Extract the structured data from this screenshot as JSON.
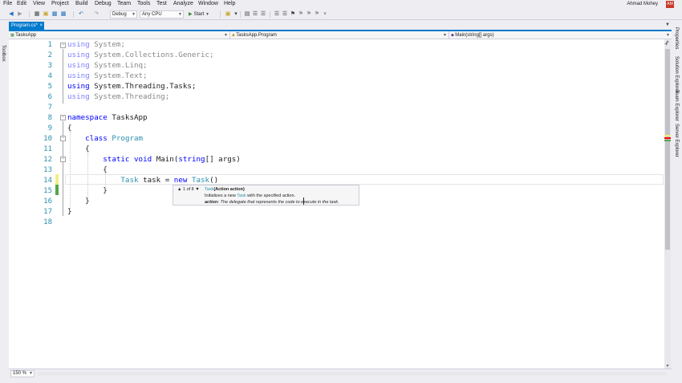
{
  "menu": [
    "File",
    "Edit",
    "View",
    "Project",
    "Build",
    "Debug",
    "Team",
    "Tools",
    "Test",
    "Analyze",
    "Window",
    "Help"
  ],
  "user": {
    "name": "Ahmad Mohey",
    "initials": "AM"
  },
  "toolbar": {
    "configuration": "Debug",
    "platform": "Any CPU",
    "start_label": "Start"
  },
  "side_panels": {
    "left": "Toolbox",
    "right": [
      "Properties",
      "Solution Explorer",
      "Team Explorer",
      "Server Explorer"
    ]
  },
  "tabs": [
    {
      "label": "Program.cs*",
      "close": "×"
    }
  ],
  "navbar": {
    "project": "TasksApp",
    "type": "TasksApp.Program",
    "member": "Main(string[] args)"
  },
  "code_lines": [
    "using System;",
    "using System.Collections.Generic;",
    "using System.Linq;",
    "using System.Text;",
    "using System.Threading.Tasks;",
    "using System.Threading;",
    "",
    "namespace TasksApp",
    "{",
    "    class Program",
    "    {",
    "        static void Main(string[] args)",
    "        {",
    "            Task task = new Task()",
    "        }",
    "    }",
    "}",
    ""
  ],
  "tooltip": {
    "overload": "1 of 8",
    "sig_type": "Task",
    "sig_param": "(Action action)",
    "desc_pre": "Initializes a new ",
    "desc_type": "Task",
    "desc_post": " with the specified action.",
    "param_name": "action:",
    "param_desc": " The delegate that represents the code to execute in the task."
  },
  "zoom": "150 %",
  "colors": {
    "accent": "#007acc",
    "keyword": "#0000ff",
    "type": "#2b91af",
    "line_number": "#2b91af",
    "unsaved_change": "#efef81",
    "saved_change": "#57a64a",
    "error": "#ff0000"
  }
}
